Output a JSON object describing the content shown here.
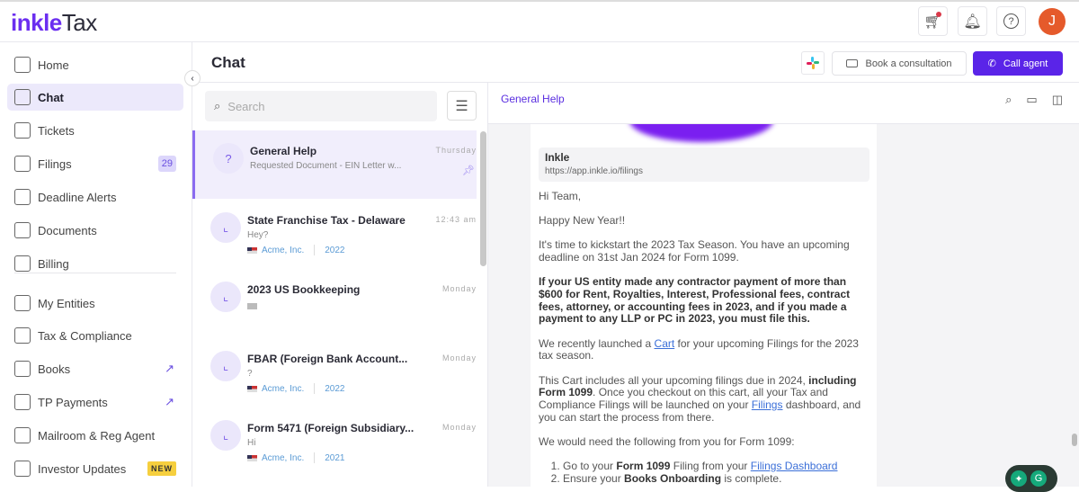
{
  "brand": {
    "part1": "inkle",
    "part2": "Tax"
  },
  "topbar": {
    "avatar_initial": "J",
    "cart_icon": "cart-icon",
    "bell_icon": "bell-icon",
    "help_icon": "help-icon"
  },
  "sidebar": {
    "items": [
      {
        "label": "Home",
        "icon": "home-icon"
      },
      {
        "label": "Chat",
        "icon": "chat-icon",
        "selected": true
      },
      {
        "label": "Tickets",
        "icon": "ticket-icon"
      },
      {
        "label": "Filings",
        "icon": "filings-icon",
        "badge": "29"
      },
      {
        "label": "Deadline Alerts",
        "icon": "calendar-icon"
      },
      {
        "label": "Documents",
        "icon": "folder-icon"
      },
      {
        "label": "Billing",
        "icon": "billing-icon"
      },
      {
        "label": "My Entities",
        "icon": "building-icon"
      },
      {
        "label": "Tax & Compliance",
        "icon": "documents-icon"
      },
      {
        "label": "Books",
        "icon": "book-icon",
        "external": true
      },
      {
        "label": "TP Payments",
        "icon": "transfer-icon",
        "external": true
      },
      {
        "label": "Mailroom & Reg Agent",
        "icon": "mailbox-icon"
      },
      {
        "label": "Investor Updates",
        "icon": "presentation-icon",
        "badge": "NEW"
      }
    ]
  },
  "header": {
    "title": "Chat",
    "book_label": "Book a consultation",
    "call_label": "Call agent"
  },
  "search": {
    "placeholder": "Search"
  },
  "chats": [
    {
      "title": "General Help",
      "subtitle": "Requested Document - EIN Letter w...",
      "time": "Thursday",
      "pinned": true,
      "selected": true
    },
    {
      "title": "State Franchise Tax - Delaware",
      "subtitle": "Hey?",
      "time": "12:43 am",
      "entity": "Acme, Inc.",
      "year": "2022"
    },
    {
      "title": "2023 US Bookkeeping",
      "subtitle": "",
      "time": "Monday"
    },
    {
      "title": "FBAR (Foreign Bank Account...",
      "subtitle": "?",
      "time": "Monday",
      "entity": "Acme, Inc.",
      "year": "2022"
    },
    {
      "title": "Form 5471 (Foreign Subsidiary...",
      "subtitle": "Hi",
      "time": "Monday",
      "entity": "Acme, Inc.",
      "year": "2021"
    }
  ],
  "detail": {
    "title": "General Help",
    "preview": {
      "title": "Inkle",
      "url": "https://app.inkle.io/filings"
    },
    "msg": {
      "greet": "Hi Team,",
      "newyear": "Happy New Year!!",
      "p1": "It's time to kickstart the 2023 Tax Season. You have an upcoming deadline on 31st Jan 2024 for Form 1099.",
      "p2": "If your US entity made any contractor payment of more than $600 for Rent, Royalties, Interest, Professional fees, contract fees, attorney, or accounting fees in 2023, and if you made a payment to any LLP or PC in 2023, you must file this.",
      "p3a": "We recently launched a ",
      "p3link": "Cart",
      "p3b": " for your upcoming Filings for the 2023 tax season.",
      "p4a": "This Cart includes all your upcoming filings due in 2024, ",
      "p4b": "including Form 1099",
      "p4c": ". Once you checkout on this cart, all your Tax and Compliance Filings will be launched on your ",
      "p4link": "Filings",
      "p4d": " dashboard, and you can start the process from there.",
      "p5": "We would need the following from you for Form 1099:",
      "l1a": "Go to your ",
      "l1b": "Form 1099",
      "l1c": " Filing from your ",
      "l1link": "Filings Dashboard",
      "l2a": "Ensure your ",
      "l2b": "Books Onboarding",
      "l2c": " is complete."
    }
  }
}
